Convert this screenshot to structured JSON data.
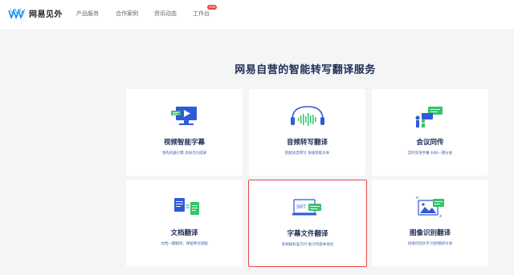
{
  "brand": {
    "name": "网易见外"
  },
  "nav": {
    "items": [
      "产品服务",
      "合作案例",
      "资讯动态",
      "工作台"
    ],
    "badge": "new"
  },
  "headline": "网易自营的智能转写翻译服务",
  "cards": [
    {
      "title": "视频智能字幕",
      "desc": "领先机器引擎 高效交付成果",
      "icon": "monitor-subtitle-icon"
    },
    {
      "title": "音频转写翻译",
      "desc": "智能语音转写 快速获取文本",
      "icon": "headphones-waveform-icon"
    },
    {
      "title": "会议同传",
      "desc": "实时双语字幕 扫码一键分发",
      "icon": "conference-speaker-icon"
    },
    {
      "title": "文档翻译",
      "desc": "文档一键翻译，保留原文排版",
      "icon": "document-translate-icon"
    },
    {
      "title": "字幕文件翻译",
      "desc": "央视级标准交付 助力内容本地化",
      "icon": "srt-file-icon"
    },
    {
      "title": "图像识别翻译",
      "desc": "快速识别文字 同步翻译文本",
      "icon": "image-recognition-icon"
    }
  ],
  "colors": {
    "accent": "#2e5bd8",
    "green": "#35c46b",
    "title": "#1f2d55",
    "selected_border": "#e54848"
  }
}
